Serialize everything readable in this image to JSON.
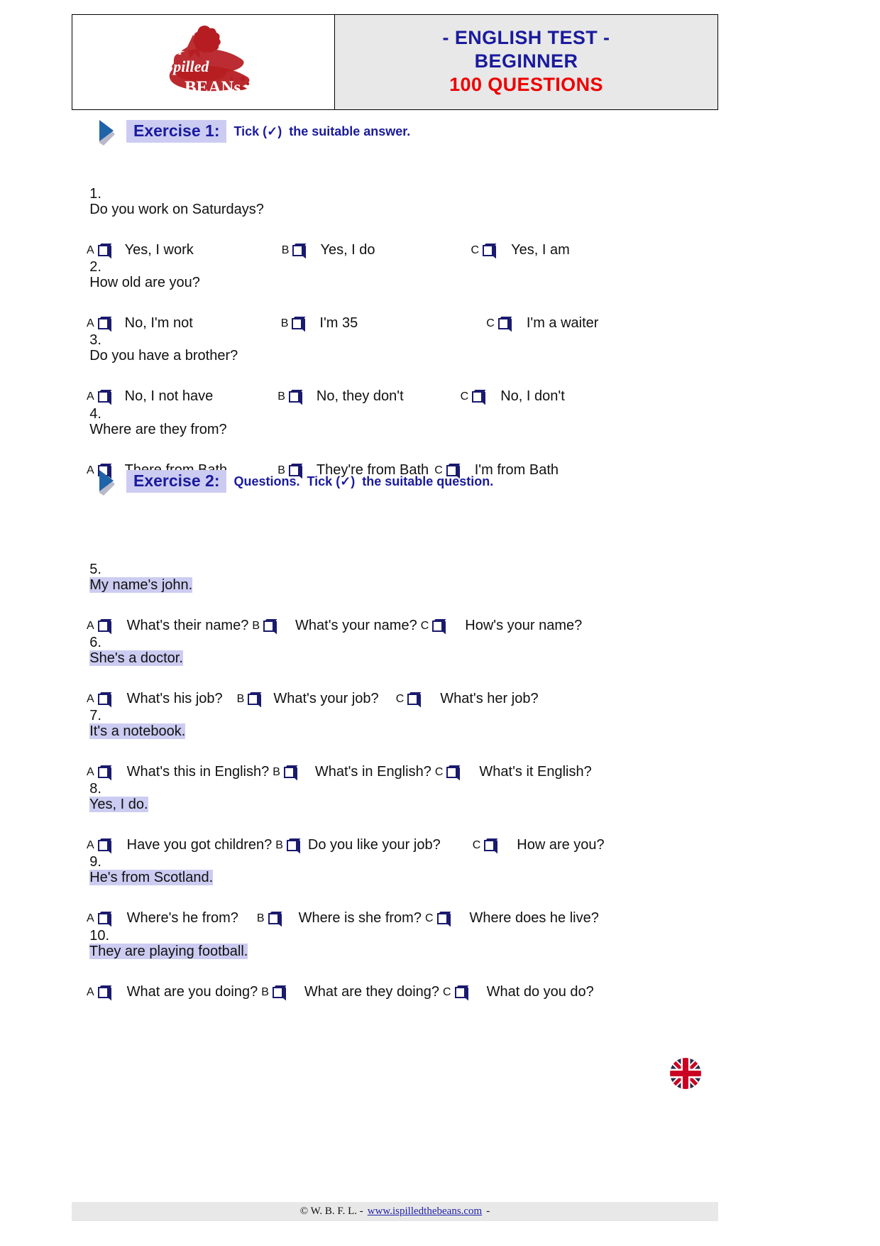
{
  "header": {
    "logo_alt": "I Spilled the Beans",
    "title_line1": "- ENGLISH TEST -",
    "title_line2": "BEGINNER",
    "title_line3": "100 QUESTIONS",
    "title_color": "#1a1a9e",
    "accent_color": "#ee0000"
  },
  "exercises": [
    {
      "label": "Exercise 1:",
      "instruction": "Tick (✓)  the suitable answer."
    },
    {
      "label": "Exercise 2:",
      "instruction": "Questions.  Tick (✓)  the suitable question."
    }
  ],
  "questions": [
    {
      "number": "1.",
      "prompt": "Do you work on Saturdays?",
      "highlighted": false,
      "options": [
        {
          "letter": "A",
          "text": "Yes, I work"
        },
        {
          "letter": "B",
          "text": "Yes, I do"
        },
        {
          "letter": "C",
          "text": "Yes, I am"
        }
      ]
    },
    {
      "number": "2.",
      "prompt": "How old are you?",
      "highlighted": false,
      "options": [
        {
          "letter": "A",
          "text": "No, I'm not"
        },
        {
          "letter": "B",
          "text": "I'm 35"
        },
        {
          "letter": "C",
          "text": "I'm a waiter"
        }
      ]
    },
    {
      "number": "3.",
      "prompt": "Do you have a brother?",
      "highlighted": false,
      "options": [
        {
          "letter": "A",
          "text": "No, I not have"
        },
        {
          "letter": "B",
          "text": "No, they don't"
        },
        {
          "letter": "C",
          "text": "No, I don't"
        }
      ]
    },
    {
      "number": "4.",
      "prompt": "Where are they from?",
      "highlighted": false,
      "options": [
        {
          "letter": "A",
          "text": "There from Bath"
        },
        {
          "letter": "B",
          "text": "They're from Bath"
        },
        {
          "letter": "C",
          "text": "I'm from Bath"
        }
      ]
    },
    {
      "number": "5.",
      "prompt": "My name's john.",
      "highlighted": true,
      "options": [
        {
          "letter": "A",
          "text": "What's their name?"
        },
        {
          "letter": "B",
          "text": "What's your name?"
        },
        {
          "letter": "C",
          "text": "How's your name?"
        }
      ]
    },
    {
      "number": "6.",
      "prompt": "She's a doctor.",
      "highlighted": true,
      "options": [
        {
          "letter": "A",
          "text": "What's his job?"
        },
        {
          "letter": "B",
          "text": "What's your job?"
        },
        {
          "letter": "C",
          "text": "What's her job?"
        }
      ]
    },
    {
      "number": "7.",
      "prompt": "It's a notebook.",
      "highlighted": true,
      "options": [
        {
          "letter": "A",
          "text": "What's this in English?"
        },
        {
          "letter": "B",
          "text": "What's in English?"
        },
        {
          "letter": "C",
          "text": "What's it English?"
        }
      ]
    },
    {
      "number": "8.",
      "prompt": "Yes, I do.",
      "highlighted": true,
      "options": [
        {
          "letter": "A",
          "text": "Have you got children?"
        },
        {
          "letter": "B",
          "text": "Do you like your job?"
        },
        {
          "letter": "C",
          "text": "How are you?"
        }
      ]
    },
    {
      "number": "9.",
      "prompt": "He's from Scotland.",
      "highlighted": true,
      "options": [
        {
          "letter": "A",
          "text": "Where's he from?"
        },
        {
          "letter": "B",
          "text": "Where is she from?"
        },
        {
          "letter": "C",
          "text": "Where does he live?"
        }
      ]
    },
    {
      "number": "10.",
      "prompt": "They are playing football.",
      "highlighted": true,
      "options": [
        {
          "letter": "A",
          "text": "What are you doing?"
        },
        {
          "letter": "B",
          "text": "What are they doing?"
        },
        {
          "letter": "C",
          "text": "What do you do?"
        }
      ]
    }
  ],
  "footer": {
    "copyright": "© W. B. F. L. -",
    "link": "www.ispilledthebeans.com",
    "trailing": "-",
    "flag_alt": "uk-flag"
  },
  "icons": {
    "arrow": "play-arrow-icon",
    "checkbox": "checkbox-icon",
    "flag": "uk-flag-icon"
  }
}
